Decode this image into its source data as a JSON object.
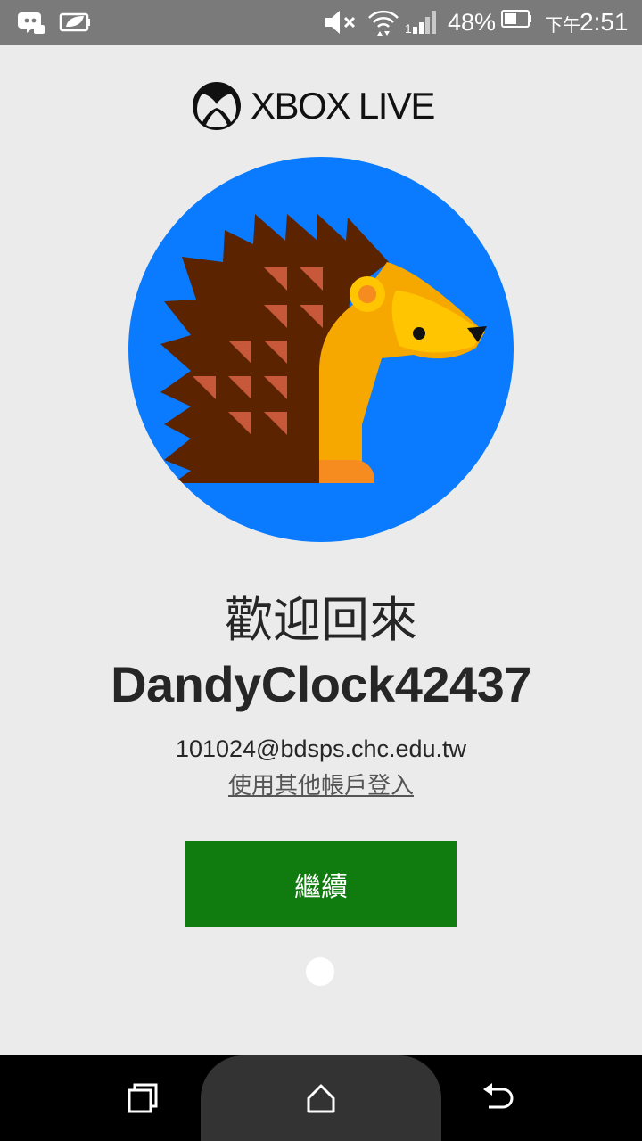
{
  "status_bar": {
    "battery_percent": "48%",
    "time_prefix": "下午",
    "time": "2:51",
    "icons": [
      "discord-icon",
      "leaf-battery-saver-icon",
      "volume-muted-icon",
      "wifi-icon",
      "signal-icon",
      "battery-icon"
    ]
  },
  "logo": {
    "text": "XBOX LIVE",
    "icon": "xbox-logo-icon"
  },
  "avatar": {
    "icon": "hedgehog-avatar-icon",
    "background_color": "#0a7bfe"
  },
  "welcome_text": "歡迎回來",
  "gamertag": "DandyClock42437",
  "email": "101024@bdsps.chc.edu.tw",
  "other_account_link": "使用其他帳戶登入",
  "continue_button": {
    "label": "繼續",
    "color": "#107c10"
  },
  "navigation_bar": {
    "icons": [
      "recents-icon",
      "home-icon",
      "back-icon"
    ]
  }
}
